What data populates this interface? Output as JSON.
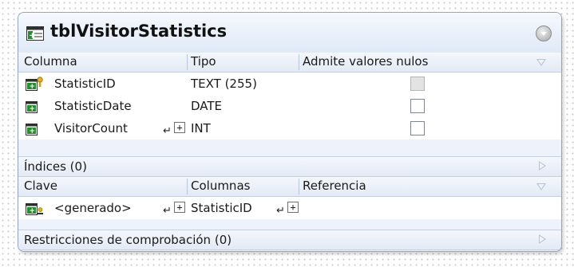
{
  "table": {
    "name": "tblVisitorStatistics"
  },
  "columns_header": {
    "col1": "Columna",
    "col2": "Tipo",
    "col3": "Admite valores nulos"
  },
  "columns": [
    {
      "name": "StatisticID",
      "type": "TEXT (255)",
      "nullable": false,
      "nullable_disabled": true,
      "icon": "primary-key-column-icon"
    },
    {
      "name": "StatisticDate",
      "type": "DATE",
      "nullable": false,
      "nullable_disabled": false,
      "icon": "column-icon"
    },
    {
      "name": "VisitorCount",
      "type": "INT",
      "nullable": false,
      "nullable_disabled": false,
      "icon": "column-icon",
      "expand": "+"
    }
  ],
  "indexes_section": {
    "label": "Índices (0)"
  },
  "keys_header": {
    "col1": "Clave",
    "col2": "Columnas",
    "col3": "Referencia"
  },
  "keys": [
    {
      "name": "<generado>",
      "columns": "StatisticID",
      "reference": "",
      "icon": "key-icon",
      "expand": "+"
    }
  ],
  "check_section": {
    "label": "Restricciones de comprobación (0)"
  }
}
